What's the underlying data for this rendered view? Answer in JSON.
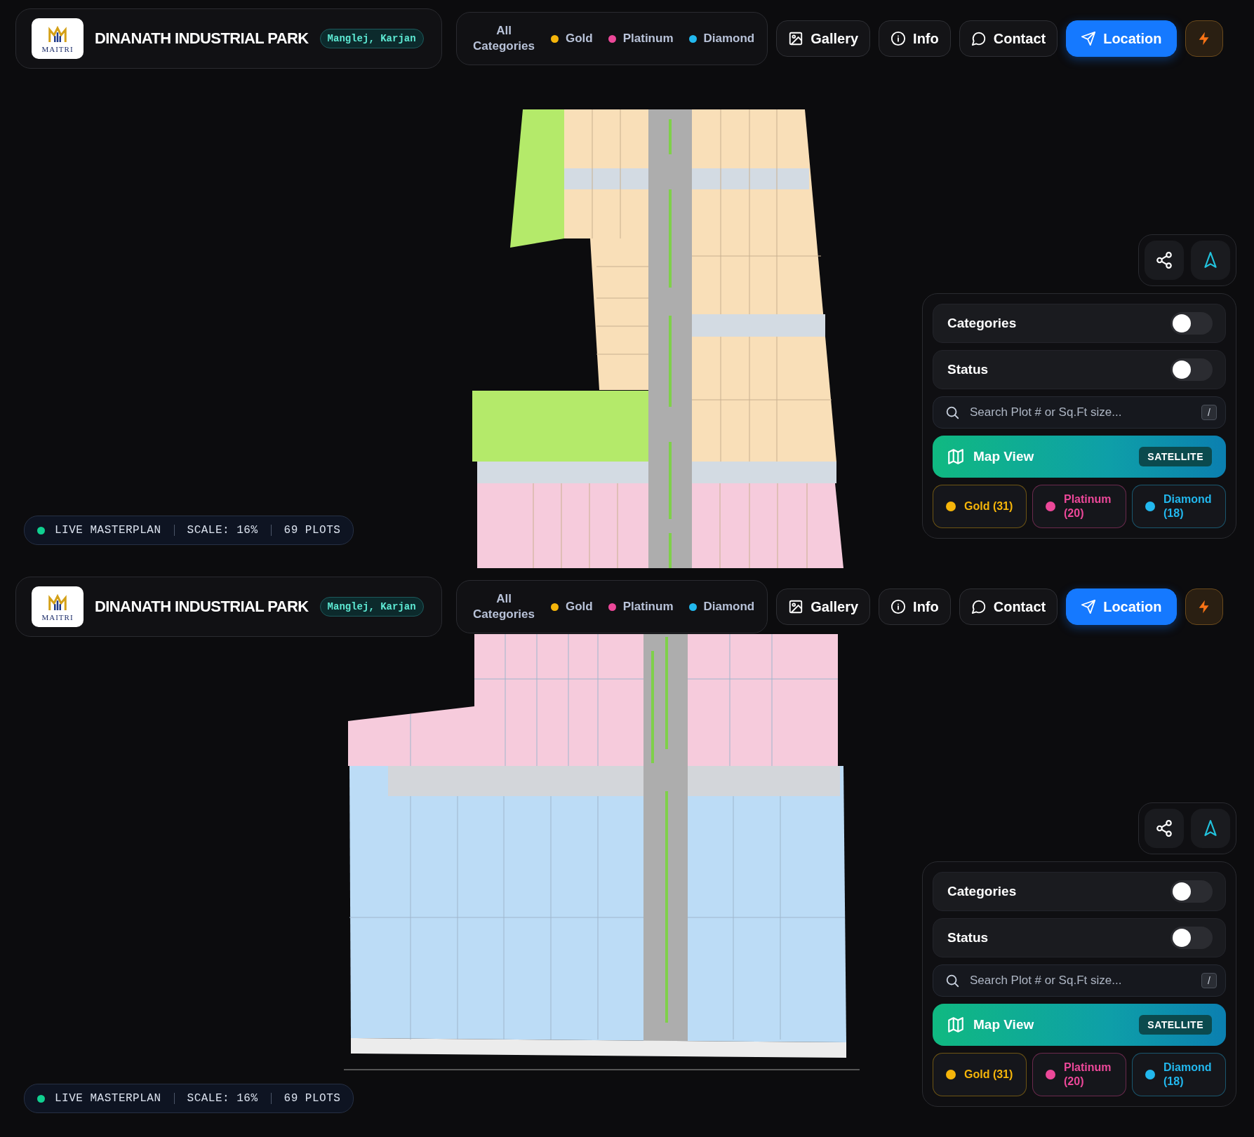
{
  "screens": [
    {
      "header": {
        "logo": "MAITRI",
        "title": "DINANATH INDUSTRIAL PARK",
        "location": "Manglej, Karjan"
      },
      "filters": [
        {
          "label": "All Categories"
        },
        {
          "label": "Gold",
          "color": "#f5b50a"
        },
        {
          "label": "Platinum",
          "color": "#ec4899"
        },
        {
          "label": "Diamond",
          "color": "#22b8ee"
        }
      ],
      "actions": [
        {
          "kind": "gallery",
          "label": "Gallery"
        },
        {
          "kind": "info",
          "label": "Info"
        },
        {
          "kind": "contact",
          "label": "Contact"
        },
        {
          "kind": "location",
          "label": "Location"
        },
        {
          "kind": "bolt"
        }
      ],
      "map_controls": [
        {
          "kind": "share"
        },
        {
          "kind": "navigate"
        }
      ],
      "toggles": [
        {
          "label": "Categories",
          "on": false
        },
        {
          "label": "Status",
          "on": false
        }
      ],
      "search": {
        "placeholder": "Search Plot # or Sq.Ft size...",
        "shortcut": "/"
      },
      "map_view": {
        "label": "Map View",
        "mode": "SATELLITE"
      },
      "legend": [
        {
          "label": "Gold (31)",
          "color": "#f5b50a"
        },
        {
          "label": "Platinum (20)",
          "color": "#ec4899"
        },
        {
          "label": "Diamond (18)",
          "color": "#22b8ee"
        }
      ],
      "status_bar": {
        "live": "LIVE MASTERPLAN",
        "scale": "SCALE: 16%",
        "plots": "69 PLOTS"
      }
    },
    {
      "header": {
        "logo": "MAITRI",
        "title": "DINANATH INDUSTRIAL PARK",
        "location": "Manglej, Karjan"
      },
      "filters": [
        {
          "label": "All Categories"
        },
        {
          "label": "Gold",
          "color": "#f5b50a"
        },
        {
          "label": "Platinum",
          "color": "#ec4899"
        },
        {
          "label": "Diamond",
          "color": "#22b8ee"
        }
      ],
      "actions": [
        {
          "kind": "gallery",
          "label": "Gallery"
        },
        {
          "kind": "info",
          "label": "Info"
        },
        {
          "kind": "contact",
          "label": "Contact"
        },
        {
          "kind": "location",
          "label": "Location"
        },
        {
          "kind": "bolt"
        }
      ],
      "map_controls": [
        {
          "kind": "share"
        },
        {
          "kind": "navigate"
        }
      ],
      "toggles": [
        {
          "label": "Categories",
          "on": false
        },
        {
          "label": "Status",
          "on": false
        }
      ],
      "search": {
        "placeholder": "Search Plot # or Sq.Ft size...",
        "shortcut": "/"
      },
      "map_view": {
        "label": "Map View",
        "mode": "SATELLITE"
      },
      "legend": [
        {
          "label": "Gold (31)",
          "color": "#f5b50a"
        },
        {
          "label": "Platinum (20)",
          "color": "#ec4899"
        },
        {
          "label": "Diamond (18)",
          "color": "#22b8ee"
        }
      ],
      "status_bar": {
        "live": "LIVE MASTERPLAN",
        "scale": "SCALE: 16%",
        "plots": "69 PLOTS"
      }
    }
  ]
}
